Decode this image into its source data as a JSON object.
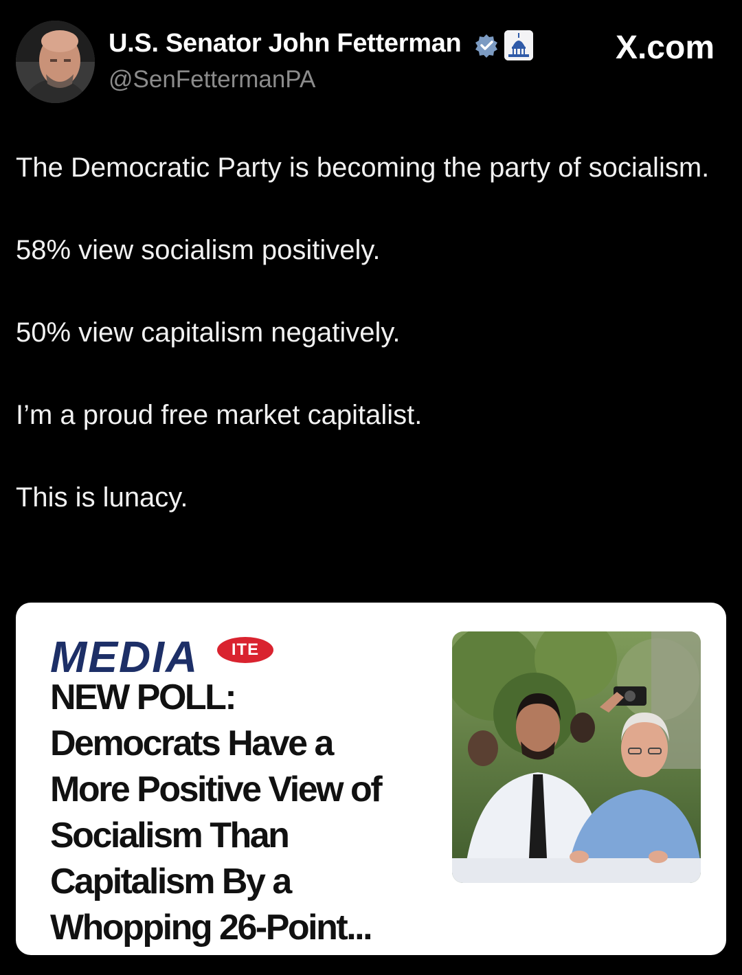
{
  "author": {
    "display_name": "U.S. Senator John Fetterman",
    "handle": "@SenFettermanPA",
    "verified_icon": "verified-badge-icon",
    "affiliation_icon": "capitol-dome-icon"
  },
  "site_label": "X.com",
  "post": {
    "paragraphs": [
      "The Democratic Party is becoming the party of socialism.",
      "58% view socialism positively.",
      "50% view capitalism negatively.",
      "I’m a proud free market capitalist.",
      "This is lunacy."
    ]
  },
  "link_card": {
    "logo_main": "MEDIA",
    "logo_badge": "ITE",
    "headline_lines": [
      "NEW POLL:",
      "Democrats Have a",
      "More Positive View of",
      "Socialism Than",
      "Capitalism By a",
      "Whopping 26-Point..."
    ]
  },
  "colors": {
    "background": "#000000",
    "handle_gray": "#8b8b8b",
    "verified_blue": "#7c9bc2",
    "logo_navy": "#1d2f67",
    "logo_red": "#d9232f"
  }
}
